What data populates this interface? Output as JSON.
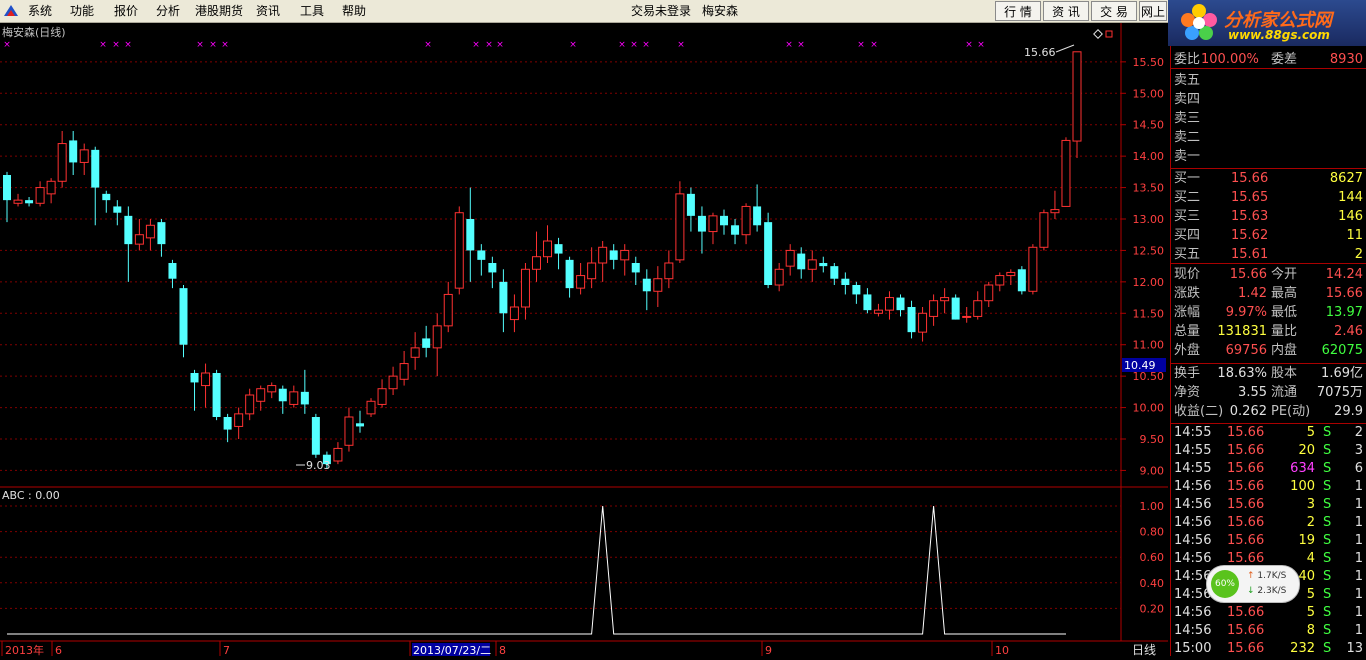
{
  "menu": {
    "items": [
      "系统",
      "功能",
      "报价",
      "分析",
      "港股期货",
      "资讯",
      "工具",
      "帮助"
    ],
    "center_status": "交易未登录",
    "center_stock": "梅安森",
    "right_buttons": [
      "行 情",
      "资 讯",
      "交 易",
      "网上"
    ]
  },
  "ad": {
    "title": "分析家公式网",
    "url": "www.88gs.com"
  },
  "chart": {
    "title": "梅安森(日线)",
    "high_label": "15.66",
    "low_label": "9.03",
    "y_ticks": [
      "15.50",
      "15.00",
      "14.50",
      "14.00",
      "13.50",
      "13.00",
      "12.50",
      "12.00",
      "11.50",
      "11.00",
      "10.50",
      "10.00",
      "9.50",
      "9.00"
    ],
    "current_price_tag": "10.49",
    "indicator_label": "ABC : 0.00",
    "indicator_ticks": [
      "1.00",
      "0.80",
      "0.60",
      "0.40",
      "0.20"
    ],
    "x_labels": [
      "2013年",
      "6",
      "7",
      "2013/07/23/二",
      "8",
      "9",
      "10"
    ],
    "period": "日线",
    "colors": {
      "up": "#ff3232",
      "down": "#54ffff",
      "grid": "#800000",
      "frame": "#b00000",
      "marker": "#ff00ff"
    }
  },
  "chart_data": {
    "type": "candlestick",
    "title": "梅安森(日线)",
    "ylim": [
      8.8,
      15.8
    ],
    "candles": [
      [
        13.7,
        13.3,
        13.75,
        12.95
      ],
      [
        13.25,
        13.3,
        13.4,
        13.2
      ],
      [
        13.3,
        13.25,
        13.35,
        13.2
      ],
      [
        13.25,
        13.5,
        13.6,
        13.2
      ],
      [
        13.4,
        13.6,
        13.65,
        13.25
      ],
      [
        13.6,
        14.2,
        14.4,
        13.5
      ],
      [
        14.25,
        13.9,
        14.4,
        13.7
      ],
      [
        13.9,
        14.1,
        14.2,
        13.7
      ],
      [
        14.1,
        13.5,
        14.15,
        12.9
      ],
      [
        13.4,
        13.3,
        13.45,
        13.1
      ],
      [
        13.2,
        13.1,
        13.3,
        12.9
      ],
      [
        13.05,
        12.6,
        13.2,
        12.0
      ],
      [
        12.6,
        12.75,
        13.0,
        12.5
      ],
      [
        12.7,
        12.9,
        13.0,
        12.5
      ],
      [
        12.95,
        12.6,
        13.0,
        12.4
      ],
      [
        12.3,
        12.05,
        12.35,
        11.9
      ],
      [
        11.9,
        11.0,
        11.95,
        10.8
      ],
      [
        10.55,
        10.4,
        10.6,
        9.95
      ],
      [
        10.35,
        10.55,
        10.7,
        10.0
      ],
      [
        10.55,
        9.85,
        10.6,
        9.8
      ],
      [
        9.85,
        9.65,
        9.9,
        9.45
      ],
      [
        9.7,
        9.9,
        10.0,
        9.5
      ],
      [
        9.9,
        10.2,
        10.3,
        9.8
      ],
      [
        10.1,
        10.3,
        10.35,
        9.95
      ],
      [
        10.25,
        10.35,
        10.4,
        10.15
      ],
      [
        10.3,
        10.1,
        10.35,
        9.9
      ],
      [
        10.05,
        10.25,
        10.35,
        10.0
      ],
      [
        10.25,
        10.05,
        10.6,
        9.9
      ],
      [
        9.85,
        9.25,
        9.9,
        9.2
      ],
      [
        9.25,
        9.1,
        9.3,
        9.03
      ],
      [
        9.15,
        9.35,
        9.45,
        9.1
      ],
      [
        9.4,
        9.85,
        10.0,
        9.3
      ],
      [
        9.75,
        9.7,
        9.95,
        9.6
      ],
      [
        9.9,
        10.1,
        10.15,
        9.85
      ],
      [
        10.05,
        10.3,
        10.45,
        10.0
      ],
      [
        10.3,
        10.5,
        10.65,
        10.2
      ],
      [
        10.45,
        10.7,
        10.9,
        10.35
      ],
      [
        10.8,
        10.95,
        11.2,
        10.6
      ],
      [
        11.1,
        10.95,
        11.3,
        10.8
      ],
      [
        10.95,
        11.3,
        11.5,
        10.5
      ],
      [
        11.3,
        11.8,
        12.0,
        11.2
      ],
      [
        11.9,
        13.1,
        13.2,
        11.8
      ],
      [
        13.0,
        12.5,
        13.5,
        12.0
      ],
      [
        12.5,
        12.35,
        12.6,
        12.1
      ],
      [
        12.3,
        12.15,
        12.4,
        11.9
      ],
      [
        12.0,
        11.5,
        12.2,
        11.2
      ],
      [
        11.4,
        11.6,
        11.8,
        11.2
      ],
      [
        11.6,
        12.2,
        12.3,
        11.4
      ],
      [
        12.2,
        12.4,
        12.8,
        12.0
      ],
      [
        12.4,
        12.65,
        12.9,
        12.3
      ],
      [
        12.6,
        12.45,
        12.7,
        12.2
      ],
      [
        12.35,
        11.9,
        12.4,
        11.75
      ],
      [
        11.9,
        12.1,
        12.3,
        11.8
      ],
      [
        12.05,
        12.3,
        12.55,
        11.9
      ],
      [
        12.3,
        12.55,
        12.65,
        12.0
      ],
      [
        12.5,
        12.35,
        12.6,
        12.2
      ],
      [
        12.35,
        12.5,
        12.6,
        12.1
      ],
      [
        12.3,
        12.15,
        12.4,
        11.95
      ],
      [
        12.05,
        11.85,
        12.2,
        11.55
      ],
      [
        11.85,
        12.05,
        12.25,
        11.6
      ],
      [
        12.05,
        12.3,
        12.5,
        11.9
      ],
      [
        12.35,
        13.4,
        13.6,
        12.3
      ],
      [
        13.4,
        13.05,
        13.5,
        12.8
      ],
      [
        13.05,
        12.8,
        13.2,
        12.45
      ],
      [
        12.8,
        13.05,
        13.1,
        12.6
      ],
      [
        13.05,
        12.9,
        13.15,
        12.75
      ],
      [
        12.9,
        12.75,
        13.0,
        12.6
      ],
      [
        12.75,
        13.2,
        13.25,
        12.6
      ],
      [
        13.2,
        12.9,
        13.55,
        12.8
      ],
      [
        12.95,
        11.95,
        13.1,
        11.9
      ],
      [
        11.95,
        12.2,
        12.3,
        11.85
      ],
      [
        12.25,
        12.5,
        12.6,
        12.1
      ],
      [
        12.45,
        12.2,
        12.55,
        12.05
      ],
      [
        12.2,
        12.35,
        12.5,
        12.0
      ],
      [
        12.3,
        12.25,
        12.4,
        12.15
      ],
      [
        12.25,
        12.05,
        12.3,
        11.95
      ],
      [
        12.05,
        11.95,
        12.15,
        11.8
      ],
      [
        11.95,
        11.8,
        12.0,
        11.65
      ],
      [
        11.8,
        11.55,
        11.9,
        11.5
      ],
      [
        11.5,
        11.55,
        11.65,
        11.45
      ],
      [
        11.55,
        11.75,
        11.85,
        11.4
      ],
      [
        11.75,
        11.55,
        11.8,
        11.45
      ],
      [
        11.6,
        11.2,
        11.7,
        11.1
      ],
      [
        11.2,
        11.5,
        11.6,
        11.05
      ],
      [
        11.45,
        11.7,
        11.8,
        11.3
      ],
      [
        11.7,
        11.75,
        11.9,
        11.5
      ],
      [
        11.75,
        11.4,
        11.8,
        11.4
      ],
      [
        11.45,
        11.45,
        11.6,
        11.35
      ],
      [
        11.45,
        11.7,
        11.85,
        11.4
      ],
      [
        11.7,
        11.95,
        12.0,
        11.6
      ],
      [
        11.95,
        12.1,
        12.15,
        11.85
      ],
      [
        12.1,
        12.15,
        12.2,
        11.95
      ],
      [
        12.2,
        11.85,
        12.25,
        11.8
      ],
      [
        11.85,
        12.55,
        12.6,
        11.8
      ],
      [
        12.55,
        13.1,
        13.15,
        12.5
      ],
      [
        13.1,
        13.15,
        13.45,
        13.0
      ],
      [
        13.2,
        14.25,
        14.3,
        13.2
      ],
      [
        14.24,
        15.66,
        15.66,
        13.97
      ]
    ],
    "indicator": {
      "name": "ABC",
      "values": [
        0,
        0,
        0,
        0,
        0,
        0,
        0,
        0,
        0,
        0,
        0,
        0,
        0,
        0,
        0,
        0,
        0,
        0,
        0,
        0,
        0,
        0,
        0,
        0,
        0,
        0,
        0,
        0,
        0,
        0,
        0,
        0,
        0,
        0,
        0,
        0,
        0,
        0,
        0,
        0,
        0,
        0,
        0,
        0,
        0,
        0,
        0,
        0,
        0,
        0,
        0,
        0,
        0,
        0,
        1,
        0,
        0,
        0,
        0,
        0,
        0,
        0,
        0,
        0,
        0,
        0,
        0,
        0,
        0,
        0,
        0,
        0,
        0,
        0,
        0,
        0,
        0,
        0,
        0,
        0,
        0,
        0,
        0,
        0,
        1,
        0,
        0,
        0,
        0,
        0,
        0,
        0,
        0,
        0,
        0,
        0,
        0
      ]
    }
  },
  "quote": {
    "ratio_label": "委比",
    "ratio_value": "100.00%",
    "diff_label": "委差",
    "diff_value": "8930",
    "sells": [
      {
        "label": "卖五"
      },
      {
        "label": "卖四"
      },
      {
        "label": "卖三"
      },
      {
        "label": "卖二"
      },
      {
        "label": "卖一"
      }
    ],
    "buys": [
      {
        "label": "买一",
        "price": "15.66",
        "vol": "8627"
      },
      {
        "label": "买二",
        "price": "15.65",
        "vol": "144"
      },
      {
        "label": "买三",
        "price": "15.63",
        "vol": "146"
      },
      {
        "label": "买四",
        "price": "15.62",
        "vol": "11"
      },
      {
        "label": "买五",
        "price": "15.61",
        "vol": "2"
      }
    ],
    "stats": [
      {
        "l1": "现价",
        "v1": "15.66",
        "l2": "今开",
        "v2": "14.24"
      },
      {
        "l1": "涨跌",
        "v1": "1.42",
        "l2": "最高",
        "v2": "15.66"
      },
      {
        "l1": "涨幅",
        "v1": "9.97%",
        "l2": "最低",
        "v2": "13.97"
      },
      {
        "l1": "总量",
        "v1": "131831",
        "l2": "量比",
        "v2": "2.46"
      },
      {
        "l1": "外盘",
        "v1": "69756",
        "l2": "内盘",
        "v2": "62075"
      }
    ],
    "finance": [
      {
        "l1": "换手",
        "v1": "18.63%",
        "l2": "股本",
        "v2": "1.69亿"
      },
      {
        "l1": "净资",
        "v1": "3.55",
        "l2": "流通",
        "v2": "7075万"
      },
      {
        "l1": "收益(二)",
        "v1": "0.262",
        "l2": "PE(动)",
        "v2": "29.9"
      }
    ],
    "ticks": [
      {
        "time": "14:55",
        "price": "15.66",
        "vol": "5",
        "side": "S",
        "n": "2"
      },
      {
        "time": "14:55",
        "price": "15.66",
        "vol": "20",
        "side": "S",
        "n": "3"
      },
      {
        "time": "14:55",
        "price": "15.66",
        "vol": "634",
        "side": "S",
        "n": "6"
      },
      {
        "time": "14:56",
        "price": "15.66",
        "vol": "100",
        "side": "S",
        "n": "1"
      },
      {
        "time": "14:56",
        "price": "15.66",
        "vol": "3",
        "side": "S",
        "n": "1"
      },
      {
        "time": "14:56",
        "price": "15.66",
        "vol": "2",
        "side": "S",
        "n": "1"
      },
      {
        "time": "14:56",
        "price": "15.66",
        "vol": "19",
        "side": "S",
        "n": "1"
      },
      {
        "time": "14:56",
        "price": "15.66",
        "vol": "4",
        "side": "S",
        "n": "1"
      },
      {
        "time": "14:56",
        "price": "15.66",
        "vol": "40",
        "side": "S",
        "n": "1"
      },
      {
        "time": "14:56",
        "price": "15.66",
        "vol": "5",
        "side": "S",
        "n": "1"
      },
      {
        "time": "14:56",
        "price": "15.66",
        "vol": "5",
        "side": "S",
        "n": "1"
      },
      {
        "time": "14:56",
        "price": "15.66",
        "vol": "8",
        "side": "S",
        "n": "1"
      },
      {
        "time": "15:00",
        "price": "15.66",
        "vol": "232",
        "side": "S",
        "n": "13"
      }
    ]
  },
  "net_widget": {
    "percent": "60%",
    "up_speed": "1.7K/S",
    "down_speed": "2.3K/S"
  }
}
